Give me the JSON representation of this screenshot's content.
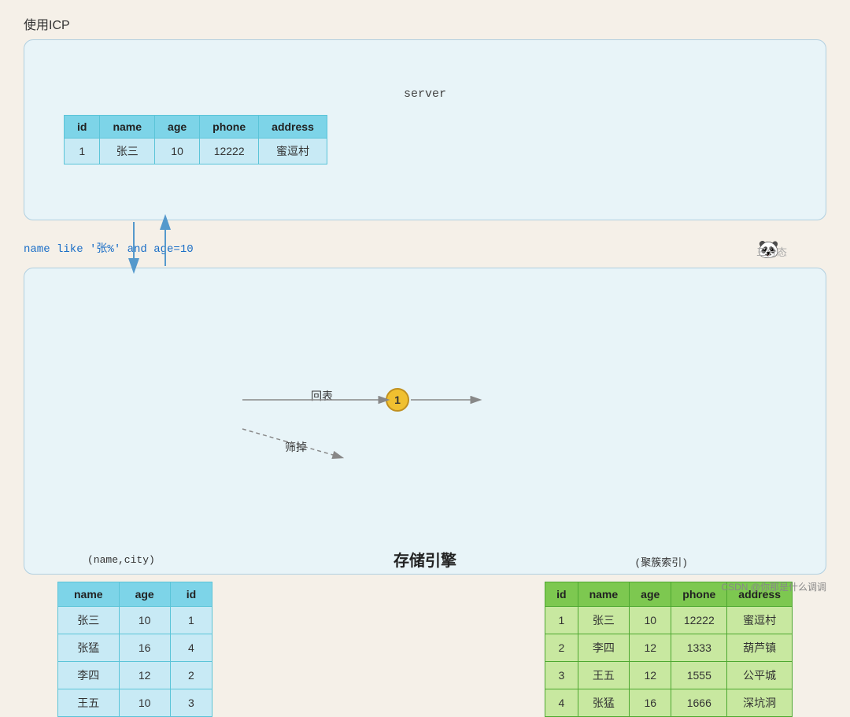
{
  "page": {
    "title": "使用ICP",
    "background_color": "#f5f0e8"
  },
  "server": {
    "label": "server",
    "table": {
      "headers": [
        "id",
        "name",
        "age",
        "phone",
        "address"
      ],
      "rows": [
        [
          "1",
          "张三",
          "10",
          "12222",
          "蜜逗村"
        ]
      ]
    }
  },
  "query": {
    "text": "name like '张%' and age=10"
  },
  "engine": {
    "label": "存储引擎",
    "index_label": "(name,city)",
    "clustered_label": "(聚簇索引)",
    "index_table": {
      "headers": [
        "name",
        "age",
        "id"
      ],
      "rows": [
        {
          "name": "张三",
          "age": "10",
          "id": "1",
          "highlight": true
        },
        {
          "name": "张猛",
          "age": "16",
          "id": "4",
          "highlight": true
        },
        {
          "name": "李四",
          "age": "12",
          "id": "2",
          "highlight": false
        },
        {
          "name": "王五",
          "age": "10",
          "id": "3",
          "highlight": false
        }
      ]
    },
    "clustered_table": {
      "headers": [
        "id",
        "name",
        "age",
        "phone",
        "address"
      ],
      "rows": [
        {
          "id": "1",
          "name": "张三",
          "age": "10",
          "phone": "12222",
          "address": "蜜逗村",
          "highlight": true
        },
        {
          "id": "2",
          "name": "李四",
          "age": "12",
          "phone": "1333",
          "address": "葫芦镇",
          "highlight": false
        },
        {
          "id": "3",
          "name": "王五",
          "age": "12",
          "phone": "1555",
          "address": "公平城",
          "highlight": false
        },
        {
          "id": "4",
          "name": "张猛",
          "age": "16",
          "phone": "1666",
          "address": "深坑洞",
          "highlight": false
        }
      ]
    }
  },
  "labels": {
    "huitao": "回表",
    "shaidiao": "筛掉",
    "watermark": "三分态",
    "footer": "CSDN @你那是什么调调",
    "circle": "1"
  }
}
